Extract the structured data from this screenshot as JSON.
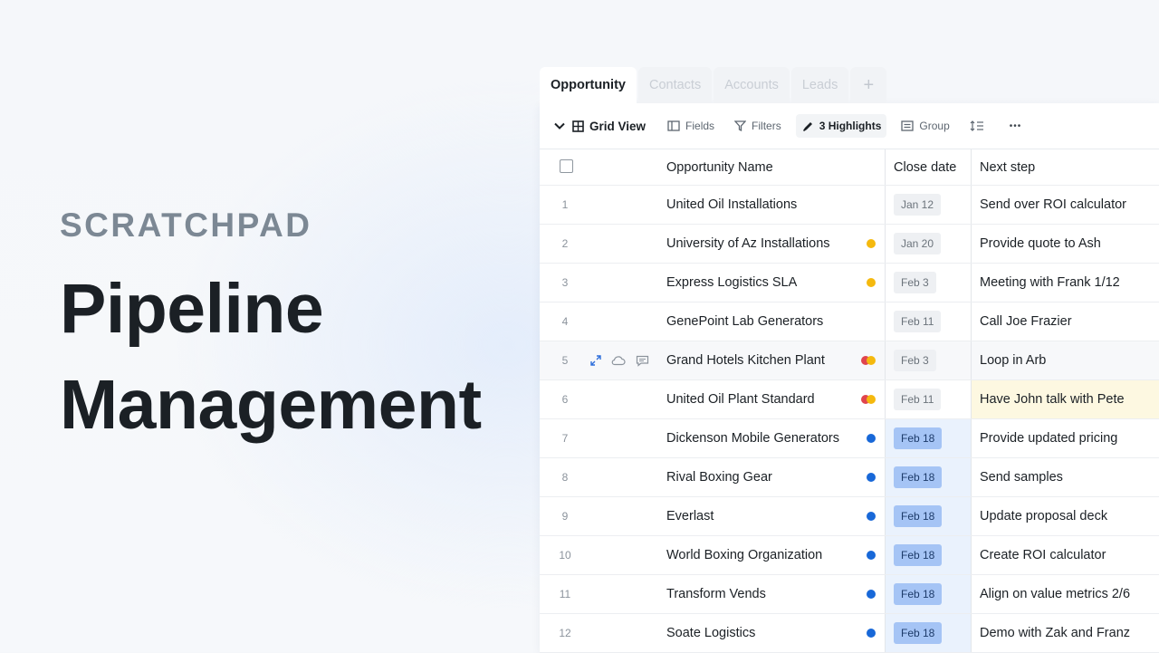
{
  "hero": {
    "brand": "SCRATCHPAD",
    "title_line1": "Pipeline",
    "title_line2": "Management"
  },
  "tabs": [
    {
      "label": "Opportunity",
      "active": true
    },
    {
      "label": "Contacts",
      "active": false
    },
    {
      "label": "Accounts",
      "active": false
    },
    {
      "label": "Leads",
      "active": false
    }
  ],
  "toolbar": {
    "view_label": "Grid View",
    "fields_label": "Fields",
    "filters_label": "Filters",
    "highlights_label": "3 Highlights",
    "group_label": "Group",
    "more_label": "•••"
  },
  "columns": {
    "name": "Opportunity Name",
    "close_date": "Close date",
    "next_step": "Next step"
  },
  "colors": {
    "yellow": "#f5b90e",
    "red": "#e0454e",
    "blue": "#1868d8",
    "accent_blue": "#2f6fdb"
  },
  "rows": [
    {
      "num": "1",
      "name": "United Oil Installations",
      "date": "Jan 12",
      "next": "Send over ROI calculator"
    },
    {
      "num": "2",
      "name": "University of Az Installations",
      "date": "Jan 20",
      "next": "Provide quote to Ash"
    },
    {
      "num": "3",
      "name": "Express Logistics SLA",
      "date": "Feb 3",
      "next": "Meeting with Frank 1/12"
    },
    {
      "num": "4",
      "name": "GenePoint Lab Generators",
      "date": "Feb 11",
      "next": "Call Joe Frazier"
    },
    {
      "num": "5",
      "name": "Grand Hotels Kitchen Plant",
      "date": "Feb 3",
      "next": "Loop in Arb"
    },
    {
      "num": "6",
      "name": "United Oil Plant Standard",
      "date": "Feb 11",
      "next": "Have John talk with Pete"
    },
    {
      "num": "7",
      "name": "Dickenson Mobile Generators",
      "date": "Feb 18",
      "next": "Provide updated pricing"
    },
    {
      "num": "8",
      "name": "Rival Boxing Gear",
      "date": "Feb 18",
      "next": "Send samples"
    },
    {
      "num": "9",
      "name": "Everlast",
      "date": "Feb 18",
      "next": "Update proposal deck"
    },
    {
      "num": "10",
      "name": "World Boxing Organization",
      "date": "Feb 18",
      "next": "Create ROI calculator"
    },
    {
      "num": "11",
      "name": "Transform Vends",
      "date": "Feb 18",
      "next": "Align on value metrics 2/6"
    },
    {
      "num": "12",
      "name": "Soate Logistics",
      "date": "Feb 18",
      "next": "Demo with Zak and Franz"
    }
  ]
}
